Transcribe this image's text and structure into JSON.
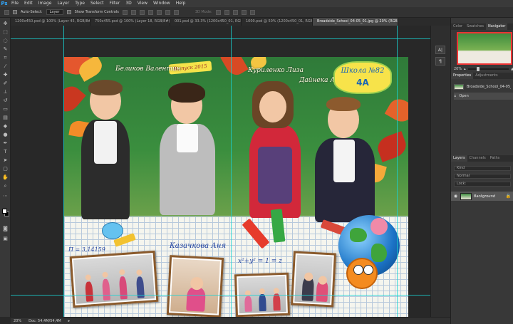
{
  "app": {
    "logo": "Ps"
  },
  "menu": [
    "File",
    "Edit",
    "Image",
    "Layer",
    "Type",
    "Select",
    "Filter",
    "3D",
    "View",
    "Window",
    "Help"
  ],
  "options": {
    "auto_select_label": "Auto-Select:",
    "auto_select_value": "Layer",
    "transform_label": "Show Transform Controls",
    "mode_3d": "3D Mode:"
  },
  "tabs": [
    {
      "label": "1200x450.psd @ 100% (Layer 45, RGB/8#)",
      "active": false
    },
    {
      "label": "750x455.psd @ 100% (Layer 18, RGB/8#)",
      "active": false
    },
    {
      "label": "001.psd @ 33.3% (1200x450_01, RGB/8)",
      "active": false
    },
    {
      "label": "1000.psd @ 50% (1200x450_01, RGB/8#)",
      "active": false
    },
    {
      "label": "Broadside_School_04-05_01.jpg @ 20% (RGB/8)",
      "active": true
    }
  ],
  "artwork": {
    "ribbon": "Выпуск 2015",
    "name_1": "Беликов Валентин",
    "name_2": "Куриленко Лиза",
    "name_3": "Дайнека Артур",
    "name_4": "Казачкова Аня",
    "school_line": "Школа №82",
    "class_label": "4А",
    "formula_left": "П = 3,14159",
    "formula_right": "x²+y² = 1 = z"
  },
  "status": {
    "zoom": "20%",
    "doc": "Doc: 54,4M/54,4M"
  },
  "right_strip": {
    "btn_1": "A|",
    "btn_2": "¶"
  },
  "panels": {
    "tabs_top": [
      "Color",
      "Swatches",
      "Navigator"
    ],
    "zoom_value": "20%",
    "tabs_mid": [
      "Properties",
      "Adjustments"
    ],
    "history_item_1": "Broadside_School_04-05_01.jpg",
    "history_item_2": "Open",
    "tabs_layers": [
      "Layers",
      "Channels",
      "Paths"
    ],
    "kind_placeholder": "Kind",
    "blend_mode": "Normal",
    "lock_label": "Lock:",
    "layer_name": "Background"
  }
}
